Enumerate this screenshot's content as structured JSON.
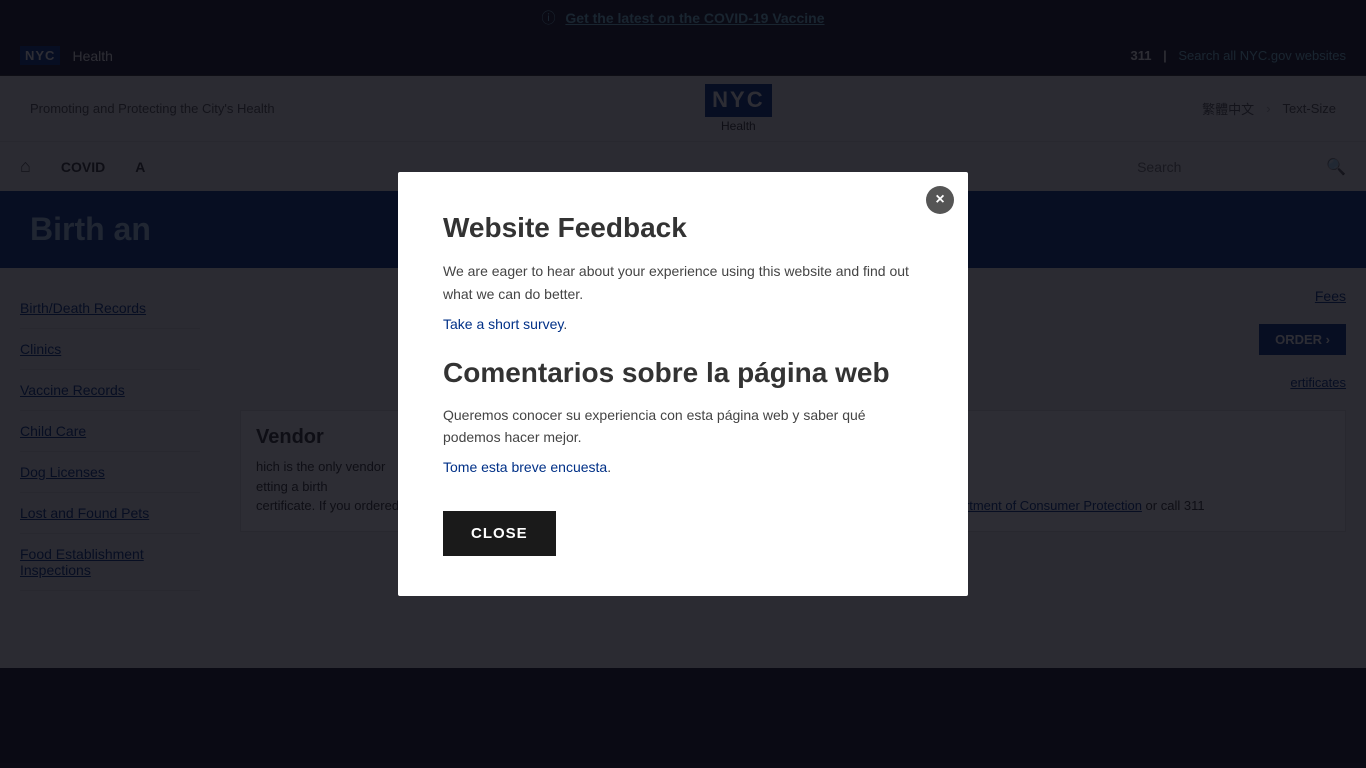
{
  "covid_banner": {
    "icon": "ⓘ",
    "link_text": "Get the latest on the COVID-19 Vaccine"
  },
  "nyc_bar": {
    "logo": "NYC",
    "department": "Health",
    "three_eleven": "311",
    "search_link": "Search all NYC.gov websites"
  },
  "main_header": {
    "tagline": "Promoting and Protecting the City's Health",
    "logo_text": "NYC",
    "health_label": "Health",
    "lang_link": "繁體中文",
    "text_size_link": "Text-Size"
  },
  "nav": {
    "home_icon": "⌂",
    "items": [
      "COVID",
      "A",
      "Search"
    ],
    "search_placeholder": "Search"
  },
  "page_title": "Birth an",
  "sidebar": {
    "items": [
      {
        "label": "Birth/Death Records"
      },
      {
        "label": "Clinics"
      },
      {
        "label": "Vaccine Records"
      },
      {
        "label": "Child Care"
      },
      {
        "label": "Dog Licenses"
      },
      {
        "label": "Lost and Found Pets"
      },
      {
        "label": "Food Establishment Inspections"
      }
    ]
  },
  "content": {
    "fees_link": "Fees",
    "order_button": "ORDER ›",
    "certificates_link": "ertificates",
    "vendor_title": "Vendor",
    "vendor_text_1": "hich is the only vendor",
    "vendor_text_2": "etting a birth",
    "vendor_text_3": "certificate. If you ordered a certificate through an unauthorized vendor and would like to file a complaint, visit the",
    "complaint_link": "NYC Department of Consumer Protection",
    "call_text": "or call 311"
  },
  "modal": {
    "close_x_label": "×",
    "english": {
      "title": "Website Feedback",
      "body": "We are eager to hear about your experience using this website and find out what we can do better.",
      "survey_link_text": "Take a short survey",
      "survey_link_suffix": "."
    },
    "spanish": {
      "title": "Comentarios sobre la página web",
      "body": "Queremos conocer su experiencia con esta página web y saber qué podemos hacer mejor.",
      "survey_link_text": "Tome esta breve encuesta",
      "survey_link_suffix": "."
    },
    "close_button_label": "CLOSE"
  }
}
